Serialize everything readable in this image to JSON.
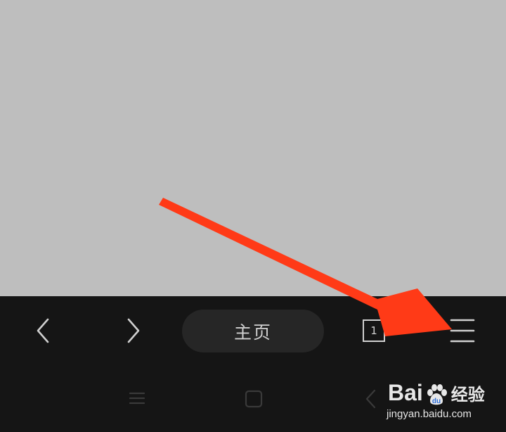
{
  "browser_toolbar": {
    "back_icon": "chevron-left-icon",
    "forward_icon": "chevron-right-icon",
    "home_label": "主页",
    "tab_count": "1",
    "menu_icon": "hamburger-menu-icon"
  },
  "system_nav": {
    "menu_icon": "recent-apps-icon",
    "home_icon": "home-square-icon",
    "back_icon": "back-icon"
  },
  "annotation": {
    "arrow_color": "#ff3a17",
    "points_to": "menu"
  },
  "watermark": {
    "brand_left": "Bai",
    "brand_right": "经验",
    "url": "jingyan.baidu.com"
  },
  "colors": {
    "content_bg": "#bebebe",
    "toolbar_bg": "#151515",
    "pill_bg": "#262626",
    "icon_color": "#d0d0d0"
  }
}
